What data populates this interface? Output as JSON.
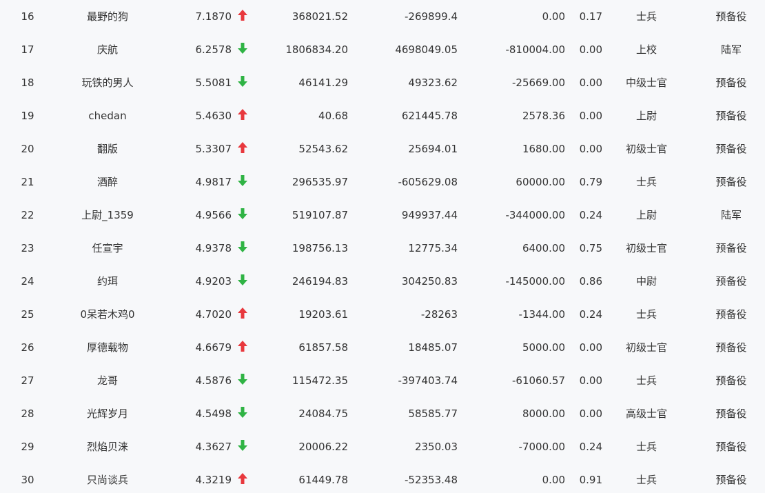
{
  "colors": {
    "up": "#e8383d",
    "down": "#2fb344",
    "text": "#333333",
    "background": "#f7f8fa"
  },
  "rows": [
    {
      "rank": "16",
      "name": "最野的狗",
      "score": "7.1870",
      "trend": "up",
      "v1": "368021.52",
      "v2": "-269899.4",
      "v3": "0.00",
      "v4": "0.17",
      "rank_title": "士兵",
      "service": "预备役"
    },
    {
      "rank": "17",
      "name": "庆航",
      "score": "6.2578",
      "trend": "down",
      "v1": "1806834.20",
      "v2": "4698049.05",
      "v3": "-810004.00",
      "v4": "0.00",
      "rank_title": "上校",
      "service": "陆军"
    },
    {
      "rank": "18",
      "name": "玩铁的男人",
      "score": "5.5081",
      "trend": "down",
      "v1": "46141.29",
      "v2": "49323.62",
      "v3": "-25669.00",
      "v4": "0.00",
      "rank_title": "中级士官",
      "service": "预备役"
    },
    {
      "rank": "19",
      "name": "chedan",
      "score": "5.4630",
      "trend": "up",
      "v1": "40.68",
      "v2": "621445.78",
      "v3": "2578.36",
      "v4": "0.00",
      "rank_title": "上尉",
      "service": "预备役"
    },
    {
      "rank": "20",
      "name": "翻版",
      "score": "5.3307",
      "trend": "up",
      "v1": "52543.62",
      "v2": "25694.01",
      "v3": "1680.00",
      "v4": "0.00",
      "rank_title": "初级士官",
      "service": "预备役"
    },
    {
      "rank": "21",
      "name": "酒醉",
      "score": "4.9817",
      "trend": "down",
      "v1": "296535.97",
      "v2": "-605629.08",
      "v3": "60000.00",
      "v4": "0.79",
      "rank_title": "士兵",
      "service": "预备役"
    },
    {
      "rank": "22",
      "name": "上尉_1359",
      "score": "4.9566",
      "trend": "down",
      "v1": "519107.87",
      "v2": "949937.44",
      "v3": "-344000.00",
      "v4": "0.24",
      "rank_title": "上尉",
      "service": "陆军"
    },
    {
      "rank": "23",
      "name": "任宣宇",
      "score": "4.9378",
      "trend": "down",
      "v1": "198756.13",
      "v2": "12775.34",
      "v3": "6400.00",
      "v4": "0.75",
      "rank_title": "初级士官",
      "service": "预备役"
    },
    {
      "rank": "24",
      "name": "约珥",
      "score": "4.9203",
      "trend": "down",
      "v1": "246194.83",
      "v2": "304250.83",
      "v3": "-145000.00",
      "v4": "0.86",
      "rank_title": "中尉",
      "service": "预备役"
    },
    {
      "rank": "25",
      "name": "0呆若木鸡0",
      "score": "4.7020",
      "trend": "up",
      "v1": "19203.61",
      "v2": "-28263",
      "v3": "-1344.00",
      "v4": "0.24",
      "rank_title": "士兵",
      "service": "预备役"
    },
    {
      "rank": "26",
      "name": "厚德载物",
      "score": "4.6679",
      "trend": "up",
      "v1": "61857.58",
      "v2": "18485.07",
      "v3": "5000.00",
      "v4": "0.00",
      "rank_title": "初级士官",
      "service": "预备役"
    },
    {
      "rank": "27",
      "name": "龙哥",
      "score": "4.5876",
      "trend": "down",
      "v1": "115472.35",
      "v2": "-397403.74",
      "v3": "-61060.57",
      "v4": "0.00",
      "rank_title": "士兵",
      "service": "预备役"
    },
    {
      "rank": "28",
      "name": "光辉岁月",
      "score": "4.5498",
      "trend": "down",
      "v1": "24084.75",
      "v2": "58585.77",
      "v3": "8000.00",
      "v4": "0.00",
      "rank_title": "高级士官",
      "service": "预备役"
    },
    {
      "rank": "29",
      "name": "烈焰贝涞",
      "score": "4.3627",
      "trend": "down",
      "v1": "20006.22",
      "v2": "2350.03",
      "v3": "-7000.00",
      "v4": "0.24",
      "rank_title": "士兵",
      "service": "预备役"
    },
    {
      "rank": "30",
      "name": "只尚谈兵",
      "score": "4.3219",
      "trend": "up",
      "v1": "61449.78",
      "v2": "-52353.48",
      "v3": "0.00",
      "v4": "0.91",
      "rank_title": "士兵",
      "service": "预备役"
    }
  ]
}
